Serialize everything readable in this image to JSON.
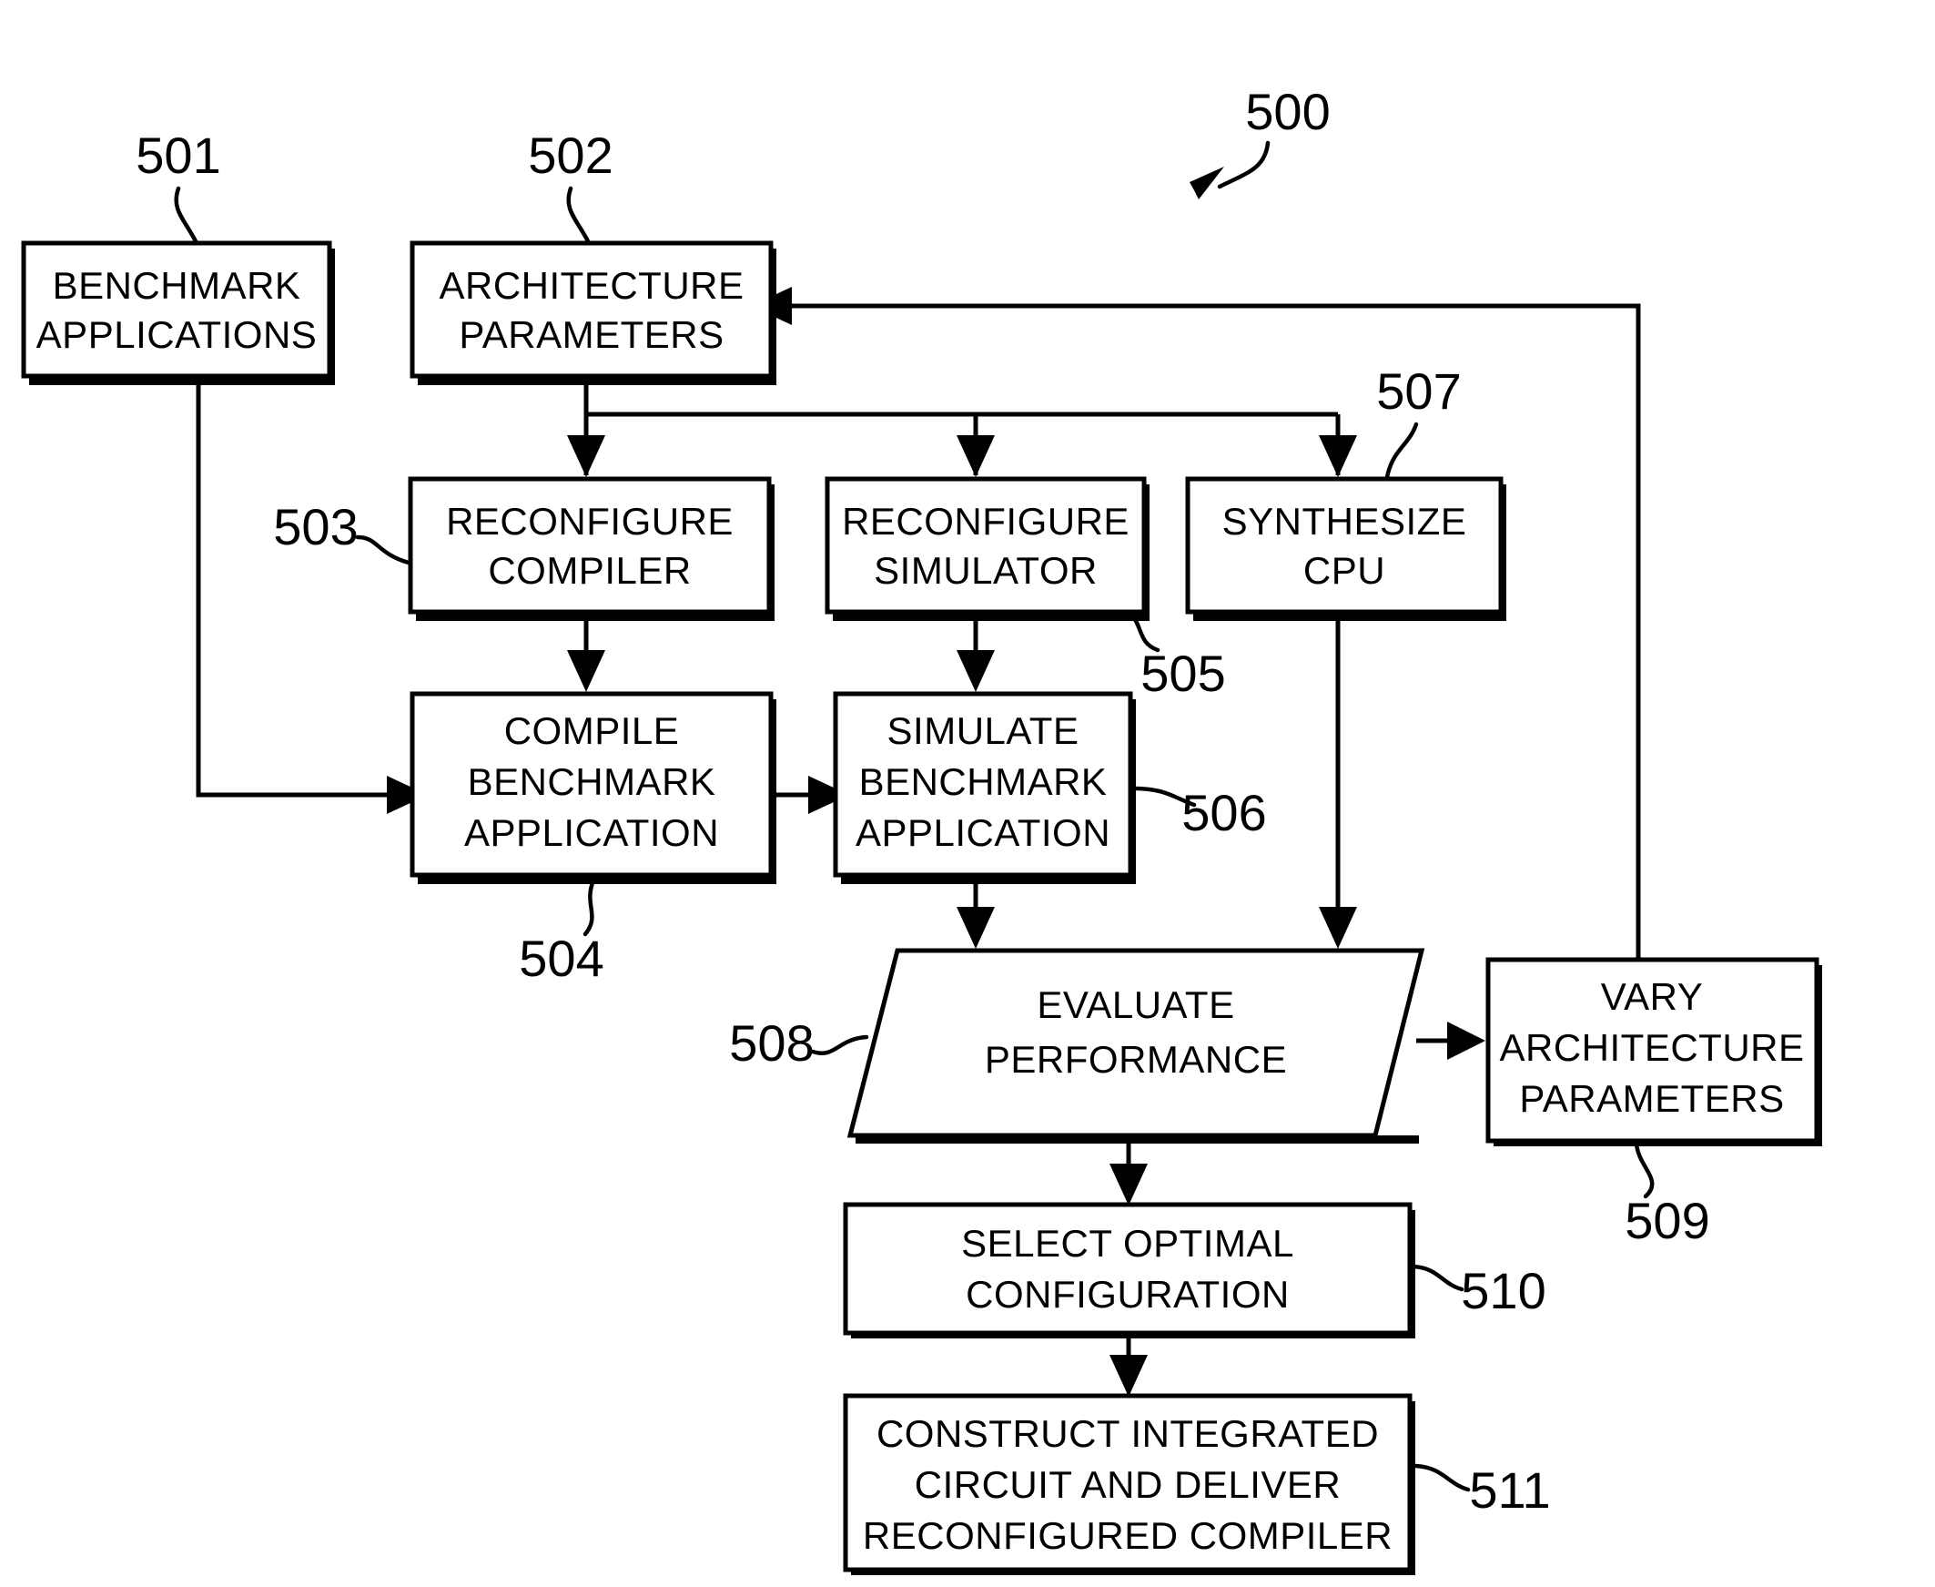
{
  "figure": {
    "reference_number": "500",
    "type": "patent-flowchart"
  },
  "nodes": {
    "benchmark_applications": {
      "ref": "501",
      "lines": [
        "BENCHMARK",
        "APPLICATIONS"
      ],
      "shape": "rectangle"
    },
    "architecture_parameters": {
      "ref": "502",
      "lines": [
        "ARCHITECTURE",
        "PARAMETERS"
      ],
      "shape": "rectangle"
    },
    "reconfigure_compiler": {
      "ref": "503",
      "lines": [
        "RECONFIGURE",
        "COMPILER"
      ],
      "shape": "rectangle"
    },
    "compile_benchmark_application": {
      "ref": "504",
      "lines": [
        "COMPILE",
        "BENCHMARK",
        "APPLICATION"
      ],
      "shape": "rectangle"
    },
    "reconfigure_simulator": {
      "ref": "505",
      "lines": [
        "RECONFIGURE",
        "SIMULATOR"
      ],
      "shape": "rectangle"
    },
    "simulate_benchmark_application": {
      "ref": "506",
      "lines": [
        "SIMULATE",
        "BENCHMARK",
        "APPLICATION"
      ],
      "shape": "rectangle"
    },
    "synthesize_cpu": {
      "ref": "507",
      "lines": [
        "SYNTHESIZE",
        "CPU"
      ],
      "shape": "rectangle"
    },
    "evaluate_performance": {
      "ref": "508",
      "lines": [
        "EVALUATE",
        "PERFORMANCE"
      ],
      "shape": "parallelogram"
    },
    "vary_architecture_parameters": {
      "ref": "509",
      "lines": [
        "VARY",
        "ARCHITECTURE",
        "PARAMETERS"
      ],
      "shape": "rectangle"
    },
    "select_optimal_configuration": {
      "ref": "510",
      "lines": [
        "SELECT OPTIMAL",
        "CONFIGURATION"
      ],
      "shape": "rectangle"
    },
    "construct_integrated_circuit": {
      "ref": "511",
      "lines": [
        "CONSTRUCT INTEGRATED",
        "CIRCUIT AND DELIVER",
        "RECONFIGURED COMPILER"
      ],
      "shape": "rectangle"
    }
  },
  "colors": {
    "stroke": "#000000",
    "fill": "#ffffff",
    "background": "#ffffff"
  }
}
